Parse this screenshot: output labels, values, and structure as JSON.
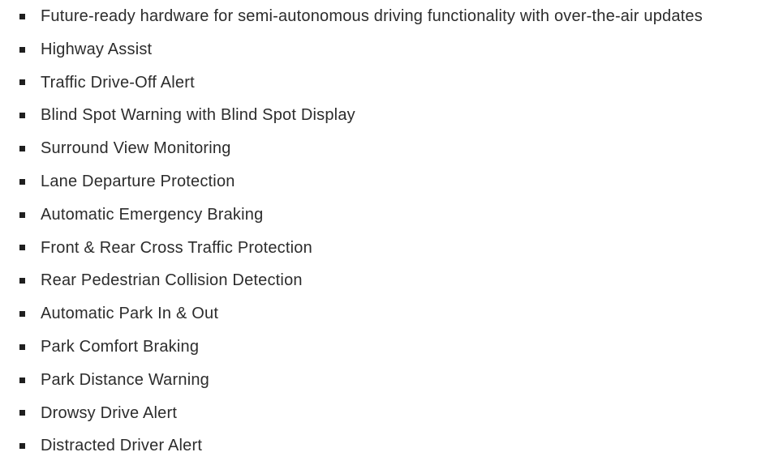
{
  "page": {
    "background_color": "#ffffff",
    "text_color": "#2c2c2c",
    "bullet_color": "#1f1f1f",
    "bullet_glyph": "square-bullet-icon"
  },
  "feature_list": {
    "marker_style": "square",
    "items": [
      {
        "label": "Future-ready hardware for semi-autonomous driving functionality with over-the-air updates"
      },
      {
        "label": "Highway Assist"
      },
      {
        "label": "Traffic Drive-Off Alert"
      },
      {
        "label": "Blind Spot Warning with Blind Spot Display"
      },
      {
        "label": "Surround View Monitoring"
      },
      {
        "label": "Lane Departure Protection"
      },
      {
        "label": "Automatic Emergency Braking"
      },
      {
        "label": "Front & Rear Cross Traffic Protection"
      },
      {
        "label": "Rear Pedestrian Collision Detection"
      },
      {
        "label": "Automatic Park In & Out"
      },
      {
        "label": "Park Comfort Braking"
      },
      {
        "label": "Park Distance Warning"
      },
      {
        "label": "Drowsy Drive Alert"
      },
      {
        "label": "Distracted Driver Alert"
      }
    ]
  }
}
